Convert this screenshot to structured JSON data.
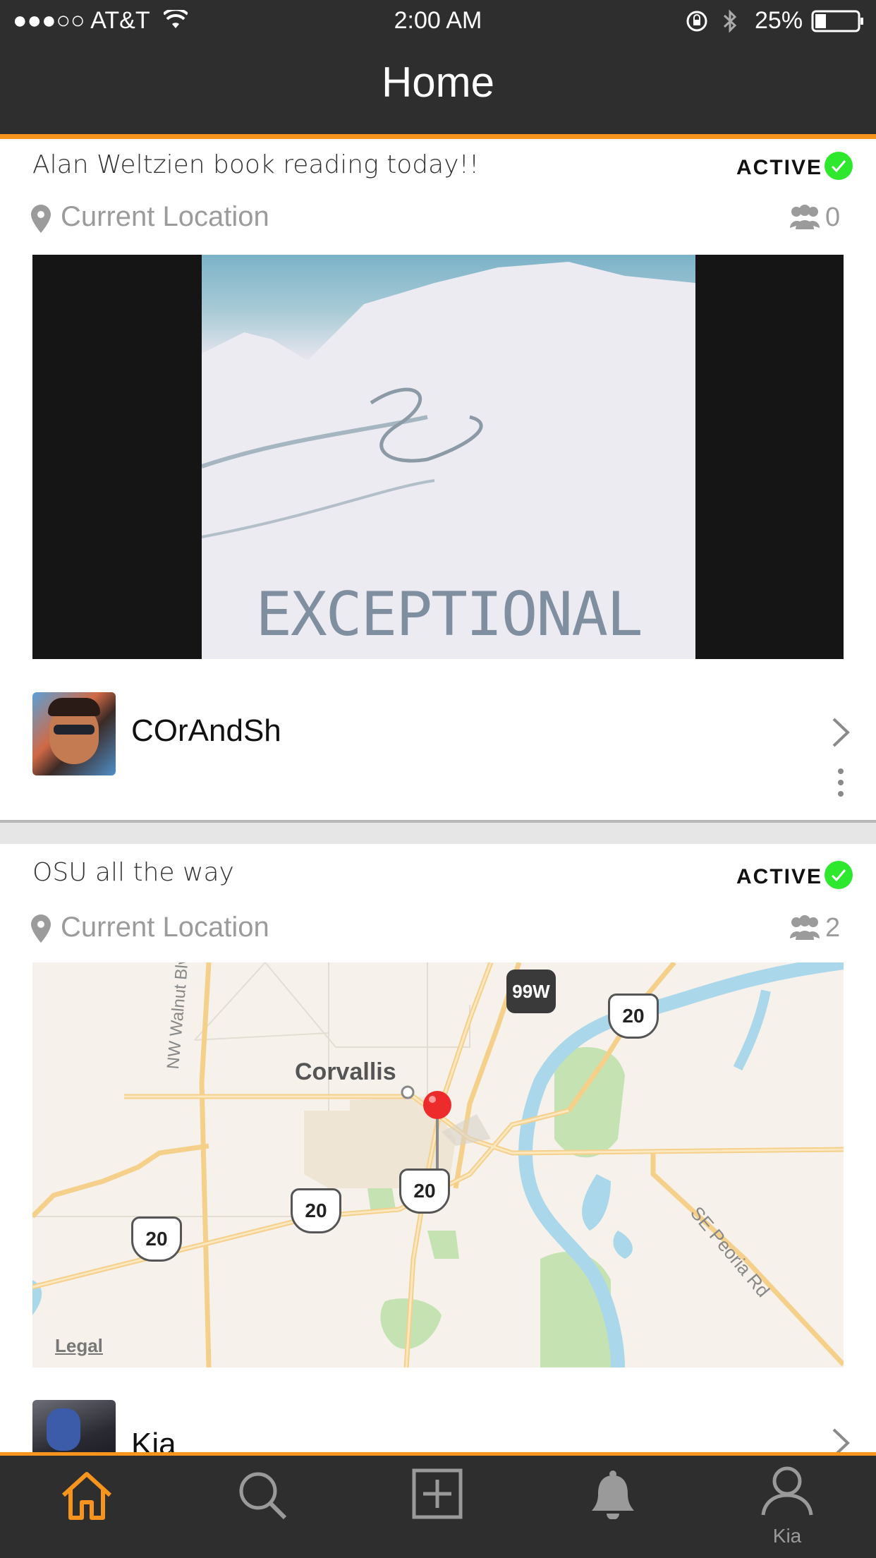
{
  "status_bar": {
    "carrier": "●●●○○ AT&T",
    "time": "2:00 AM",
    "battery": "25%"
  },
  "header": {
    "title": "Home"
  },
  "posts": [
    {
      "title": "Alan Weltzien book reading today!!",
      "status": "ACTIVE",
      "location": "Current Location",
      "attendees": "0",
      "image_text": "EXCEPTIONAL",
      "user": "COrAndSh"
    },
    {
      "title": "OSU all the way",
      "status": "ACTIVE",
      "location": "Current Location",
      "attendees": "2",
      "map": {
        "city": "Corvallis",
        "street1": "NW Walnut Blv",
        "street2": "SE Peoria Rd",
        "shield_99w": "99W",
        "shield_20": "20",
        "legal": "Legal"
      },
      "user": "Kia"
    }
  ],
  "tab_bar": {
    "profile_label": "Kia"
  },
  "colors": {
    "accent": "#f7941d",
    "active_green": "#2ee82e",
    "bar_bg": "#2e2e2e"
  }
}
